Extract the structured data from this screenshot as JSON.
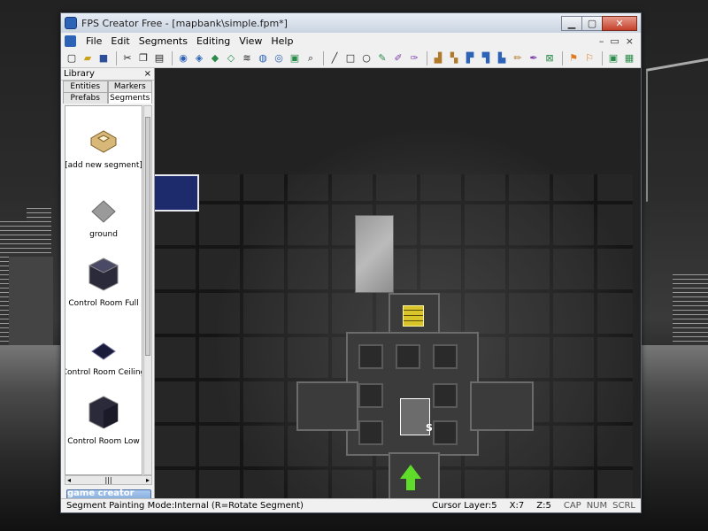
{
  "window": {
    "title": "FPS Creator Free - [mapbank\\simple.fpm*]",
    "controls": {
      "minimize": "▁",
      "maximize": "▢",
      "close": "✕"
    }
  },
  "menu": {
    "items": [
      "File",
      "Edit",
      "Segments",
      "Editing",
      "View",
      "Help"
    ],
    "mdi": {
      "minimize": "–",
      "restore": "▭",
      "close": "×"
    }
  },
  "library": {
    "title": "Library",
    "close": "×",
    "tabs": [
      {
        "label": "Entities"
      },
      {
        "label": "Markers"
      },
      {
        "label": "Prefabs"
      },
      {
        "label": "Segments"
      }
    ],
    "items": [
      {
        "label": "[add new segment]",
        "icon": "add-segment-icon"
      },
      {
        "label": "ground",
        "icon": "ground-icon"
      },
      {
        "label": "Control Room Full",
        "icon": "room-full-icon"
      },
      {
        "label": "Control Room Ceiling",
        "icon": "room-ceiling-icon"
      },
      {
        "label": "Control Room Low",
        "icon": "room-low-icon"
      }
    ],
    "hscroll": {
      "left": "◂",
      "grip": "|||",
      "right": "▸"
    },
    "store_button": "game creator store"
  },
  "editor": {
    "start_marker": "S"
  },
  "status": {
    "mode": "Segment Painting Mode:Internal (R=Rotate Segment)",
    "cursor_layer": "Cursor Layer:5",
    "x": "X:7",
    "z": "Z:5",
    "flags": [
      "CAP",
      "NUM",
      "SCRL"
    ]
  },
  "colors": {
    "accent_blue": "#2d63b7",
    "store_button": "#6e9ad4",
    "light_tile": "#d9c42a",
    "start_arrow": "#5fdc2a"
  }
}
